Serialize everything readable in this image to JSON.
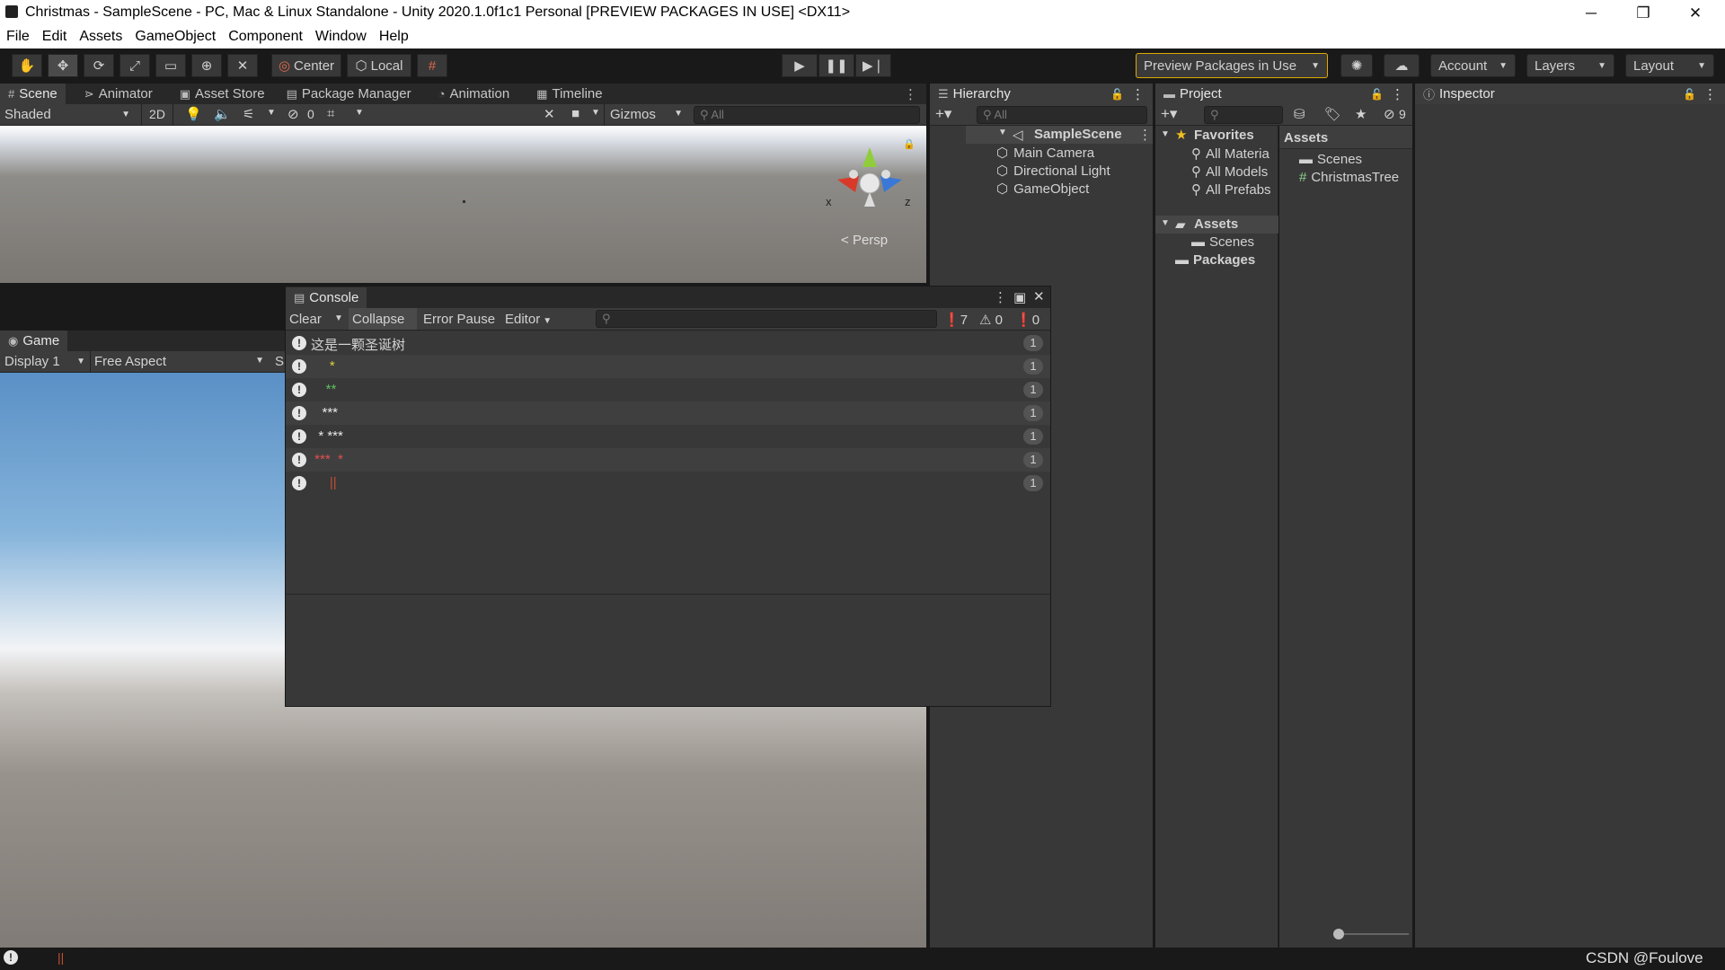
{
  "window": {
    "title": "Christmas - SampleScene - PC, Mac & Linux Standalone - Unity 2020.1.0f1c1 Personal [PREVIEW PACKAGES IN USE] <DX11>",
    "minimize": "─",
    "maximize": "❐",
    "close": "✕"
  },
  "menu": [
    "File",
    "Edit",
    "Assets",
    "GameObject",
    "Component",
    "Window",
    "Help"
  ],
  "toolbar": {
    "center_label": "Center",
    "local_label": "Local",
    "preview_packages": "Preview Packages in Use",
    "account": "Account",
    "layers": "Layers",
    "layout": "Layout"
  },
  "scene_tabs": [
    "Scene",
    "Animator",
    "Asset Store",
    "Package Manager",
    "Animation",
    "Timeline"
  ],
  "scene_bar": {
    "shading": "Shaded",
    "mode_2d": "2D",
    "hidden_count": "0",
    "gizmos": "Gizmos",
    "search_placeholder": "All",
    "persp_label": "Persp",
    "axis_x": "x",
    "axis_z": "z"
  },
  "game": {
    "tab": "Game",
    "display": "Display 1",
    "aspect": "Free Aspect",
    "scale_prefix": "S"
  },
  "hierarchy": {
    "tab": "Hierarchy",
    "search_placeholder": "All",
    "scene": "SampleScene",
    "items": [
      "Main Camera",
      "Directional Light",
      "GameObject"
    ]
  },
  "project": {
    "tab": "Project",
    "hidden_count": "9",
    "favorites_label": "Favorites",
    "favorites": [
      "All Materia",
      "All Models",
      "All Prefabs"
    ],
    "assets_label": "Assets",
    "assets_children": [
      "Scenes"
    ],
    "packages_label": "Packages",
    "right_header": "Assets",
    "right_items": [
      "Scenes",
      "ChristmasTree"
    ]
  },
  "inspector": {
    "tab": "Inspector"
  },
  "console": {
    "tab": "Console",
    "clear": "Clear",
    "collapse": "Collapse",
    "error_pause": "Error Pause",
    "editor": "Editor",
    "log_count": "7",
    "warn_count": "0",
    "error_count": "0",
    "rows": [
      {
        "text": "这是一颗圣诞树",
        "count": "1"
      },
      {
        "text": "     *",
        "count": "1"
      },
      {
        "text": "    **",
        "count": "1"
      },
      {
        "text": "   ***",
        "count": "1"
      },
      {
        "text": "  * ***",
        "count": "1"
      },
      {
        "text": " ***  *",
        "count": "1"
      },
      {
        "text": "     ||",
        "count": "1"
      }
    ]
  },
  "watermark": "CSDN @Foulove",
  "colors": {
    "preview_border": "#e0a800",
    "axis_y": "#8fce3a",
    "axis_x": "#d83a2a",
    "axis_z": "#3a78d8"
  }
}
